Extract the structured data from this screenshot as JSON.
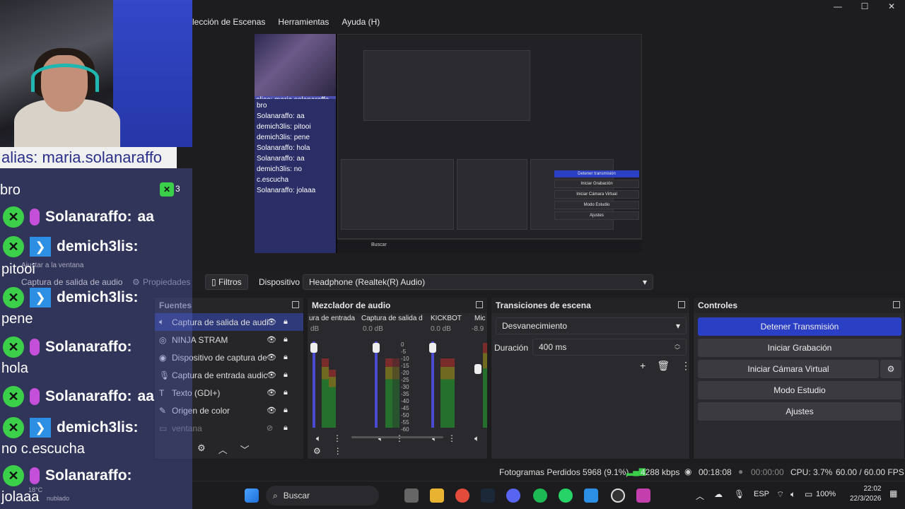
{
  "menu": {
    "items": [
      "lección de Escenas",
      "Herramientas",
      "Ayuda (H)"
    ]
  },
  "window": {
    "minimize": "—",
    "maximize": "☐",
    "close": "✕"
  },
  "overlay": {
    "alias": "alias: maria.solanaraffo",
    "chat_header": "bro",
    "viewer_count": "3",
    "messages": [
      {
        "user": "Solanaraffo:",
        "text": "aa"
      },
      {
        "user": "demich3lis:",
        "text": "pitooi"
      },
      {
        "user": "demich3lis:",
        "text": "pene"
      },
      {
        "user": "Solanaraffo:",
        "text": "hola"
      },
      {
        "user": "Solanaraffo:",
        "text": "aa"
      },
      {
        "user": "demich3lis:",
        "text": "no c.escucha"
      },
      {
        "user": "Solanaraffo:",
        "text": "jolaaa"
      }
    ],
    "ghost": {
      "adjust": "Ajustar a la ventana",
      "capture": "Captura de salida de audio",
      "weather_temp": "18°C",
      "weather": "nublado"
    }
  },
  "preview": {
    "alias": "alias: maria.solanaraffo",
    "lines": [
      "bro",
      "Solanaraffo: aa",
      "demich3lis: pitooi",
      "demich3lis: pene",
      "Solanaraffo: hola",
      "Solanaraffo: aa",
      "demich3lis: no c.escucha",
      "Solanaraffo: jolaaa"
    ],
    "inner_controls": [
      "Detener transmisión",
      "Iniciar Grabación",
      "Iniciar Cámara Virtual",
      "Modo Estudio",
      "Ajustes"
    ],
    "search": "Buscar"
  },
  "toolbar": {
    "properties": "Propiedades",
    "filters": "Filtros",
    "device_label": "Dispositivo",
    "device_value": "Headphone (Realtek(R) Audio)"
  },
  "sources": {
    "title": "Fuentes",
    "items": [
      "Captura de salida de audi",
      "NINJA STRAM",
      "Dispositivo de captura de",
      "Captura de entrada audic",
      "Texto (GDI+)",
      "Origen de color"
    ],
    "ghost_item": "ventana"
  },
  "mixer": {
    "title": "Mezclador de audio",
    "channels": [
      {
        "name": "ura de entrada",
        "db": "dB"
      },
      {
        "name": "Captura de salida d",
        "db": "0.0 dB"
      },
      {
        "name": "KICKBOT",
        "db": "0.0 dB"
      },
      {
        "name": "Mic",
        "db": "-8.9"
      }
    ],
    "scale": [
      "0",
      "-5",
      "-10",
      "-15",
      "-20",
      "-25",
      "-30",
      "-35",
      "-40",
      "-45",
      "-50",
      "-55",
      "-60"
    ]
  },
  "transitions": {
    "title": "Transiciones de escena",
    "selected": "Desvanecimiento",
    "duration_label": "Duración",
    "duration_value": "400 ms"
  },
  "controls": {
    "title": "Controles",
    "stop_stream": "Detener Transmisión",
    "start_recording": "Iniciar Grabación",
    "start_virtual_cam": "Iniciar Cámara Virtual",
    "studio_mode": "Modo Estudio",
    "settings": "Ajustes"
  },
  "status": {
    "dropped": "Fotogramas Perdidos 5968 (9.1%)",
    "bitrate": "4288 kbps",
    "live_time": "00:18:08",
    "rec_time": "00:00:00",
    "cpu": "CPU: 3.7%",
    "fps": "60.00 / 60.00 FPS"
  },
  "taskbar": {
    "search": "Buscar",
    "lang": "ESP",
    "battery": "100%",
    "time": "22:02",
    "date": "22/3/2026"
  },
  "colors": {
    "accent": "#2a3fc4",
    "selection": "#2f3a7a",
    "chat_green": "#3cd04a",
    "mic": "#c44fd8",
    "prompt": "#2d8fe3"
  }
}
